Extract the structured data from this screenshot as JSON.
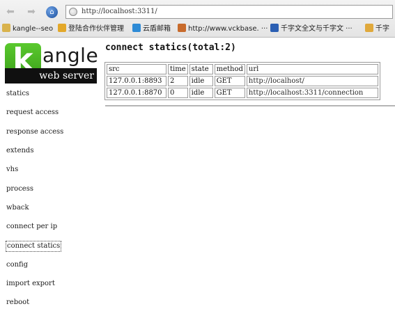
{
  "browser": {
    "url": "http://localhost:3311/",
    "bookmarks": [
      {
        "label": "kangle--seo",
        "icon": "page-icon",
        "color": "#d9b24c"
      },
      {
        "label": "登陆合作伙伴管理",
        "icon": "star-icon",
        "color": "#e3a82a"
      },
      {
        "label": "云盾邮箱",
        "icon": "mail-icon",
        "color": "#2e8bd6"
      },
      {
        "label": "http://www.vckbase. ···",
        "icon": "diamond-icon",
        "color": "#c86b2c"
      },
      {
        "label": "千字文全文与千字文 ···",
        "icon": "paw-icon",
        "color": "#2b5fb3"
      },
      {
        "label": "千字",
        "icon": "page-icon",
        "color": "#e0a93c"
      }
    ]
  },
  "logo": {
    "letter": "k",
    "wordmark": "angle",
    "subtitle": "web server",
    "accent": "#4ab523"
  },
  "nav": {
    "items": [
      {
        "label": "statics",
        "active": false
      },
      {
        "label": "request access",
        "active": false
      },
      {
        "label": "response access",
        "active": false
      },
      {
        "label": "extends",
        "active": false
      },
      {
        "label": "vhs",
        "active": false
      },
      {
        "label": "process",
        "active": false
      },
      {
        "label": "wback",
        "active": false
      },
      {
        "label": "connect per ip",
        "active": false
      },
      {
        "label": "connect statics",
        "active": true
      },
      {
        "label": "config",
        "active": false
      },
      {
        "label": "import export",
        "active": false
      },
      {
        "label": "reboot",
        "active": false
      }
    ]
  },
  "main": {
    "title": "connect statics(total:2)",
    "table": {
      "headers": [
        "src",
        "time",
        "state",
        "method",
        "url"
      ],
      "rows": [
        [
          "127.0.0.1:8893",
          "2",
          "idle",
          "GET",
          "http://localhost/"
        ],
        [
          "127.0.0.1:8870",
          "0",
          "idle",
          "GET",
          "http://localhost:3311/connection"
        ]
      ]
    }
  }
}
